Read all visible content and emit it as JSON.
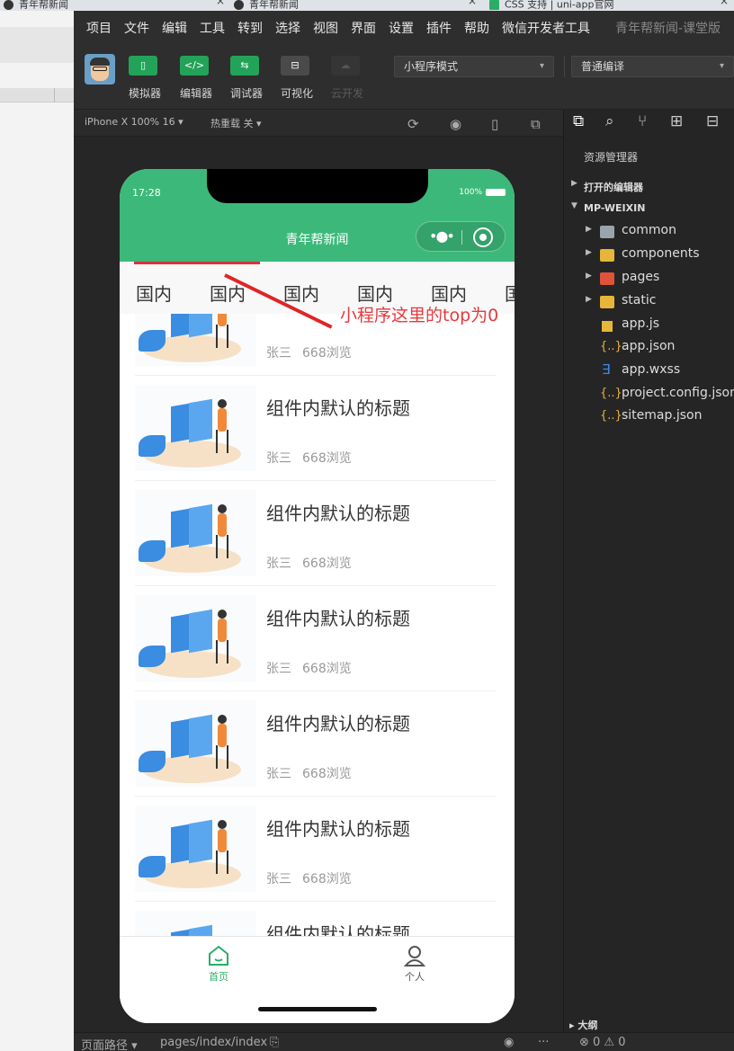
{
  "browser_tabs": [
    {
      "title": "青年帮新闻",
      "close": "×"
    },
    {
      "title": "青年帮新闻",
      "close": "×"
    },
    {
      "title": "CSS 支持 | uni-app官网",
      "close": "×"
    }
  ],
  "menu": {
    "items": [
      "项目",
      "文件",
      "编辑",
      "工具",
      "转到",
      "选择",
      "视图",
      "界面",
      "设置",
      "插件",
      "帮助",
      "微信开发者工具"
    ],
    "window_title": "青年帮新闻-课堂版"
  },
  "toolbar": {
    "buttons": [
      {
        "label": "模拟器",
        "icon": "phone-icon",
        "style": "green"
      },
      {
        "label": "编辑器",
        "icon": "code-icon",
        "style": "green"
      },
      {
        "label": "调试器",
        "icon": "debug-icon",
        "style": "green"
      },
      {
        "label": "可视化",
        "icon": "layout-icon",
        "style": "gray"
      },
      {
        "label": "云开发",
        "icon": "cloud-icon",
        "style": "dim"
      }
    ],
    "mode_select": "小程序模式",
    "compile_select": "普通编译"
  },
  "simulator": {
    "device": "iPhone X 100% 16 ▾",
    "hot_reload": "热重载 关 ▾"
  },
  "phone": {
    "time": "17:28",
    "battery": "100%",
    "nav_title": "青年帮新闻",
    "categories": [
      "国内",
      "国内",
      "国内",
      "国内",
      "国内",
      "国"
    ],
    "articles": [
      {
        "title": "",
        "author": "张三",
        "views": "668浏览"
      },
      {
        "title": "组件内默认的标题",
        "author": "张三",
        "views": "668浏览"
      },
      {
        "title": "组件内默认的标题",
        "author": "张三",
        "views": "668浏览"
      },
      {
        "title": "组件内默认的标题",
        "author": "张三",
        "views": "668浏览"
      },
      {
        "title": "组件内默认的标题",
        "author": "张三",
        "views": "668浏览"
      },
      {
        "title": "组件内默认的标题",
        "author": "张三",
        "views": "668浏览"
      },
      {
        "title": "组件内默认的标题",
        "author": "",
        "views": ""
      }
    ],
    "tabbar": {
      "home": "首页",
      "profile": "个人",
      "active_color": "#2aae67"
    }
  },
  "annotation": {
    "text": "小程序这里的top为0",
    "color": "#e02424"
  },
  "explorer": {
    "title": "资源管理器",
    "open_editors": "打开的编辑器",
    "project": "MP-WEIXIN",
    "tree": [
      {
        "name": "common",
        "type": "folder",
        "color": "#9aa4ad"
      },
      {
        "name": "components",
        "type": "folder",
        "color": "#e7b53a"
      },
      {
        "name": "pages",
        "type": "folder",
        "color": "#e0533a"
      },
      {
        "name": "static",
        "type": "folder",
        "color": "#e7b53a"
      },
      {
        "name": "app.js",
        "type": "js"
      },
      {
        "name": "app.json",
        "type": "json"
      },
      {
        "name": "app.wxss",
        "type": "wxss"
      },
      {
        "name": "project.config.json",
        "type": "json"
      },
      {
        "name": "sitemap.json",
        "type": "json"
      }
    ],
    "outline": "大纲"
  },
  "statusbar": {
    "path_label": "页面路径 ▾",
    "path": "pages/index/index",
    "problems": "⊗ 0 ⚠ 0"
  }
}
